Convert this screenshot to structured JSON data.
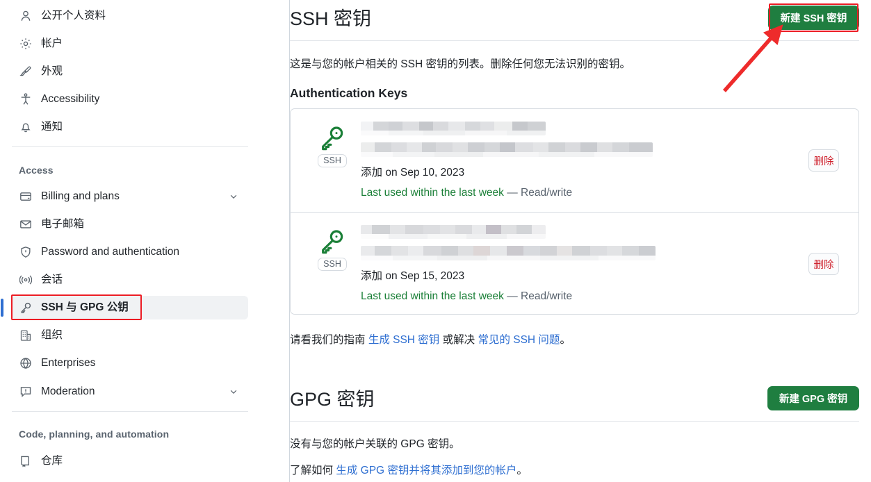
{
  "sidebar": {
    "groups": [
      {
        "label": "",
        "items": [
          {
            "label": "公开个人资料",
            "icon": "person-icon",
            "chevron": false
          },
          {
            "label": "帐户",
            "icon": "gear-icon",
            "chevron": false
          },
          {
            "label": "外观",
            "icon": "paintbrush-icon",
            "chevron": false
          },
          {
            "label": "Accessibility",
            "icon": "accessibility-icon",
            "chevron": false
          },
          {
            "label": "通知",
            "icon": "bell-icon",
            "chevron": false
          }
        ]
      },
      {
        "label": "Access",
        "items": [
          {
            "label": "Billing and plans",
            "icon": "credit-card-icon",
            "chevron": true
          },
          {
            "label": "电子邮箱",
            "icon": "mail-icon",
            "chevron": false
          },
          {
            "label": "Password and authentication",
            "icon": "shield-lock-icon",
            "chevron": false
          },
          {
            "label": "会话",
            "icon": "broadcast-icon",
            "chevron": false
          },
          {
            "label": "SSH 与 GPG 公钥",
            "icon": "key-icon",
            "chevron": false,
            "selected": true
          },
          {
            "label": "组织",
            "icon": "organization-icon",
            "chevron": false
          },
          {
            "label": "Enterprises",
            "icon": "globe-icon",
            "chevron": false
          },
          {
            "label": "Moderation",
            "icon": "report-icon",
            "chevron": true
          }
        ]
      },
      {
        "label": "Code, planning, and automation",
        "items": [
          {
            "label": "仓库",
            "icon": "repo-icon",
            "chevron": false
          }
        ]
      }
    ]
  },
  "ssh_section": {
    "title": "SSH 密钥",
    "new_key_button": "新建 SSH 密钥",
    "description": "这是与您的帐户相关的 SSH 密钥的列表。删除任何您无法识别的密钥。",
    "subsection_title": "Authentication Keys",
    "keys": [
      {
        "name_redacted": true,
        "icon": "key-icon",
        "badge": "SSH",
        "added_prefix": "添加",
        "added_on": "on Sep 10, 2023",
        "last_used": "Last used within the last week",
        "permission": "— Read/write",
        "delete_label": "删除"
      },
      {
        "name_redacted": true,
        "icon": "key-icon",
        "badge": "SSH",
        "added_prefix": "添加",
        "added_on": "on Sep 15, 2023",
        "last_used": "Last used within the last week",
        "permission": "— Read/write",
        "delete_label": "删除"
      }
    ],
    "help": {
      "prefix": "请看我们的指南",
      "link1": "生成 SSH 密钥",
      "middle": "或解决",
      "link2": "常见的 SSH 问题",
      "suffix": "。"
    }
  },
  "gpg_section": {
    "title": "GPG 密钥",
    "new_key_button": "新建 GPG 密钥",
    "empty_text": "没有与您的帐户关联的 GPG 密钥。",
    "help": {
      "prefix": "了解如何",
      "link": "生成 GPG 密钥并将其添加到您的帐户",
      "suffix": "。"
    }
  },
  "annotations": {
    "highlight_color": "#ec1c24",
    "arrow_color": "#ee2b2b",
    "selected_bar_color": "#2f6fd1",
    "button_green": "#1f7e40",
    "link_blue": "#2f6fd1",
    "status_green": "#1a7f37",
    "danger_red": "#cf222e"
  }
}
